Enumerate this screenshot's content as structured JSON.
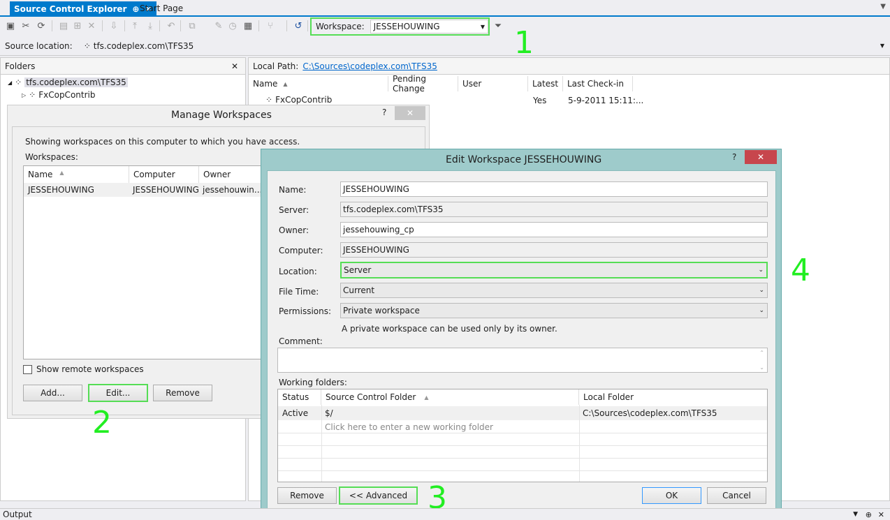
{
  "tabs": {
    "active": "Source Control Explorer",
    "active_pin": "⊕",
    "active_close": "✕",
    "other": "Start Page"
  },
  "toolbar": {
    "workspace_label": "Workspace:",
    "workspace_value": "JESSEHOUWING"
  },
  "source_location": {
    "label": "Source location:",
    "value": "tfs.codeplex.com\\TFS35"
  },
  "folders": {
    "title": "Folders",
    "root": "tfs.codeplex.com\\TFS35",
    "child": "FxCopContrib"
  },
  "items": {
    "local_path_label": "Local Path:",
    "local_path_value": "C:\\Sources\\codeplex.com\\TFS35",
    "columns": [
      "Name",
      "Pending Change",
      "User",
      "Latest",
      "Last Check-in"
    ],
    "rows": [
      {
        "name": "FxCopContrib",
        "pending": "",
        "user": "",
        "latest": "Yes",
        "last_checkin": "5-9-2011 15:11:..."
      }
    ]
  },
  "manage_workspaces": {
    "title": "Manage Workspaces",
    "help": "?",
    "close": "✕",
    "description": "Showing workspaces on this computer to which you have access.",
    "list_label": "Workspaces:",
    "columns": [
      "Name",
      "Computer",
      "Owner"
    ],
    "rows": [
      {
        "name": "JESSEHOUWING",
        "computer": "JESSEHOUWING",
        "owner": "jessehouwin..."
      }
    ],
    "show_remote": "Show remote workspaces",
    "add": "Add...",
    "edit": "Edit...",
    "remove": "Remove"
  },
  "edit_workspace": {
    "title": "Edit Workspace JESSEHOUWING",
    "help": "?",
    "close": "✕",
    "name_label": "Name:",
    "name_value": "JESSEHOUWING",
    "server_label": "Server:",
    "server_value": "tfs.codeplex.com\\TFS35",
    "owner_label": "Owner:",
    "owner_value": "jessehouwing_cp",
    "computer_label": "Computer:",
    "computer_value": "JESSEHOUWING",
    "location_label": "Location:",
    "location_value": "Server",
    "filetime_label": "File Time:",
    "filetime_value": "Current",
    "permissions_label": "Permissions:",
    "permissions_value": "Private workspace",
    "permissions_hint": "A private workspace can be used only by its owner.",
    "comment_label": "Comment:",
    "working_folders_label": "Working folders:",
    "wf_columns": [
      "Status",
      "Source Control Folder",
      "Local Folder"
    ],
    "wf_rows": [
      {
        "status": "Active",
        "folder": "$/",
        "local": "C:\\Sources\\codeplex.com\\TFS35"
      }
    ],
    "wf_placeholder": "Click here to enter a new working folder",
    "remove": "Remove",
    "advanced": "<< Advanced",
    "ok": "OK",
    "cancel": "Cancel"
  },
  "annotations": {
    "n1": "1",
    "n2": "2",
    "n3": "3",
    "n4": "4"
  },
  "output": {
    "label": "Output"
  },
  "colors": {
    "accent": "#007acc",
    "highlight": "#55dd55",
    "dialog_frame": "#9ecbcb"
  }
}
